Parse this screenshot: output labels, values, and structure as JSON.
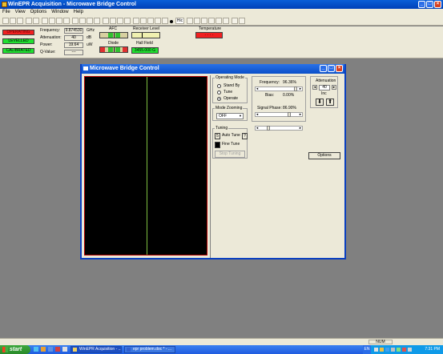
{
  "app": {
    "title": "WinEPR Acquisition - Microwave Bridge Control"
  },
  "menu": [
    "File",
    "View",
    "Options",
    "Window",
    "Help"
  ],
  "toolbar": {
    "stop_label": "Hic"
  },
  "status": {
    "operating": "OPERATING",
    "levelled": "LEVELLED",
    "calibrated": "CALIBRATED",
    "colors": {
      "operating": "#f02020",
      "ok": "#20e030"
    }
  },
  "readouts": {
    "frequency_label": "Frequency:",
    "frequency_value": "9.874530",
    "frequency_unit": "GHz",
    "attenuation_label": "Attenuation:",
    "attenuation_value": "40",
    "attenuation_unit": "dB",
    "power_label": "Power:",
    "power_value": "19.64",
    "power_unit": "uW",
    "q_label": "Q-Value:",
    "q_value": "---"
  },
  "meters": {
    "afc": "AFC",
    "receiver_level": "Receiver Level",
    "diode": "Diode",
    "hall_field": "Hall Field",
    "hall_value": "3455.000 G",
    "temperature": "Temperature",
    "temperature_value": "- - - -"
  },
  "bridge": {
    "title": "Microwave Bridge Control",
    "operating_mode_label": "Operating Mode",
    "modes": [
      "Stand By",
      "Tune",
      "Operate"
    ],
    "selected_mode": "Operate",
    "mode_zooming_label": "Mode Zooming",
    "mode_zooming_value": "OFF",
    "frequency_label": "Frequency:",
    "frequency_value": "96.36%",
    "bias_label": "Bias:",
    "bias_value": "0.00%",
    "signal_phase_label": "Signal Phase:",
    "signal_phase_value": "86.90%",
    "attenuation_label": "Attenuation",
    "attenuation_value": "40",
    "inc_label": "Inc",
    "tuning_label": "Tuning",
    "auto_tune": "Auto Tune",
    "fine_tune": "Fine Tune",
    "stop_tuning": "Stop Tuning",
    "options": "Options"
  },
  "taskbar": {
    "start": "start",
    "tasks": [
      "WinEPR Acquisition - ...",
      "epr problem.doc * - ..."
    ],
    "lang": "EN",
    "time": "7:31 PM",
    "status_num": "NUM"
  }
}
